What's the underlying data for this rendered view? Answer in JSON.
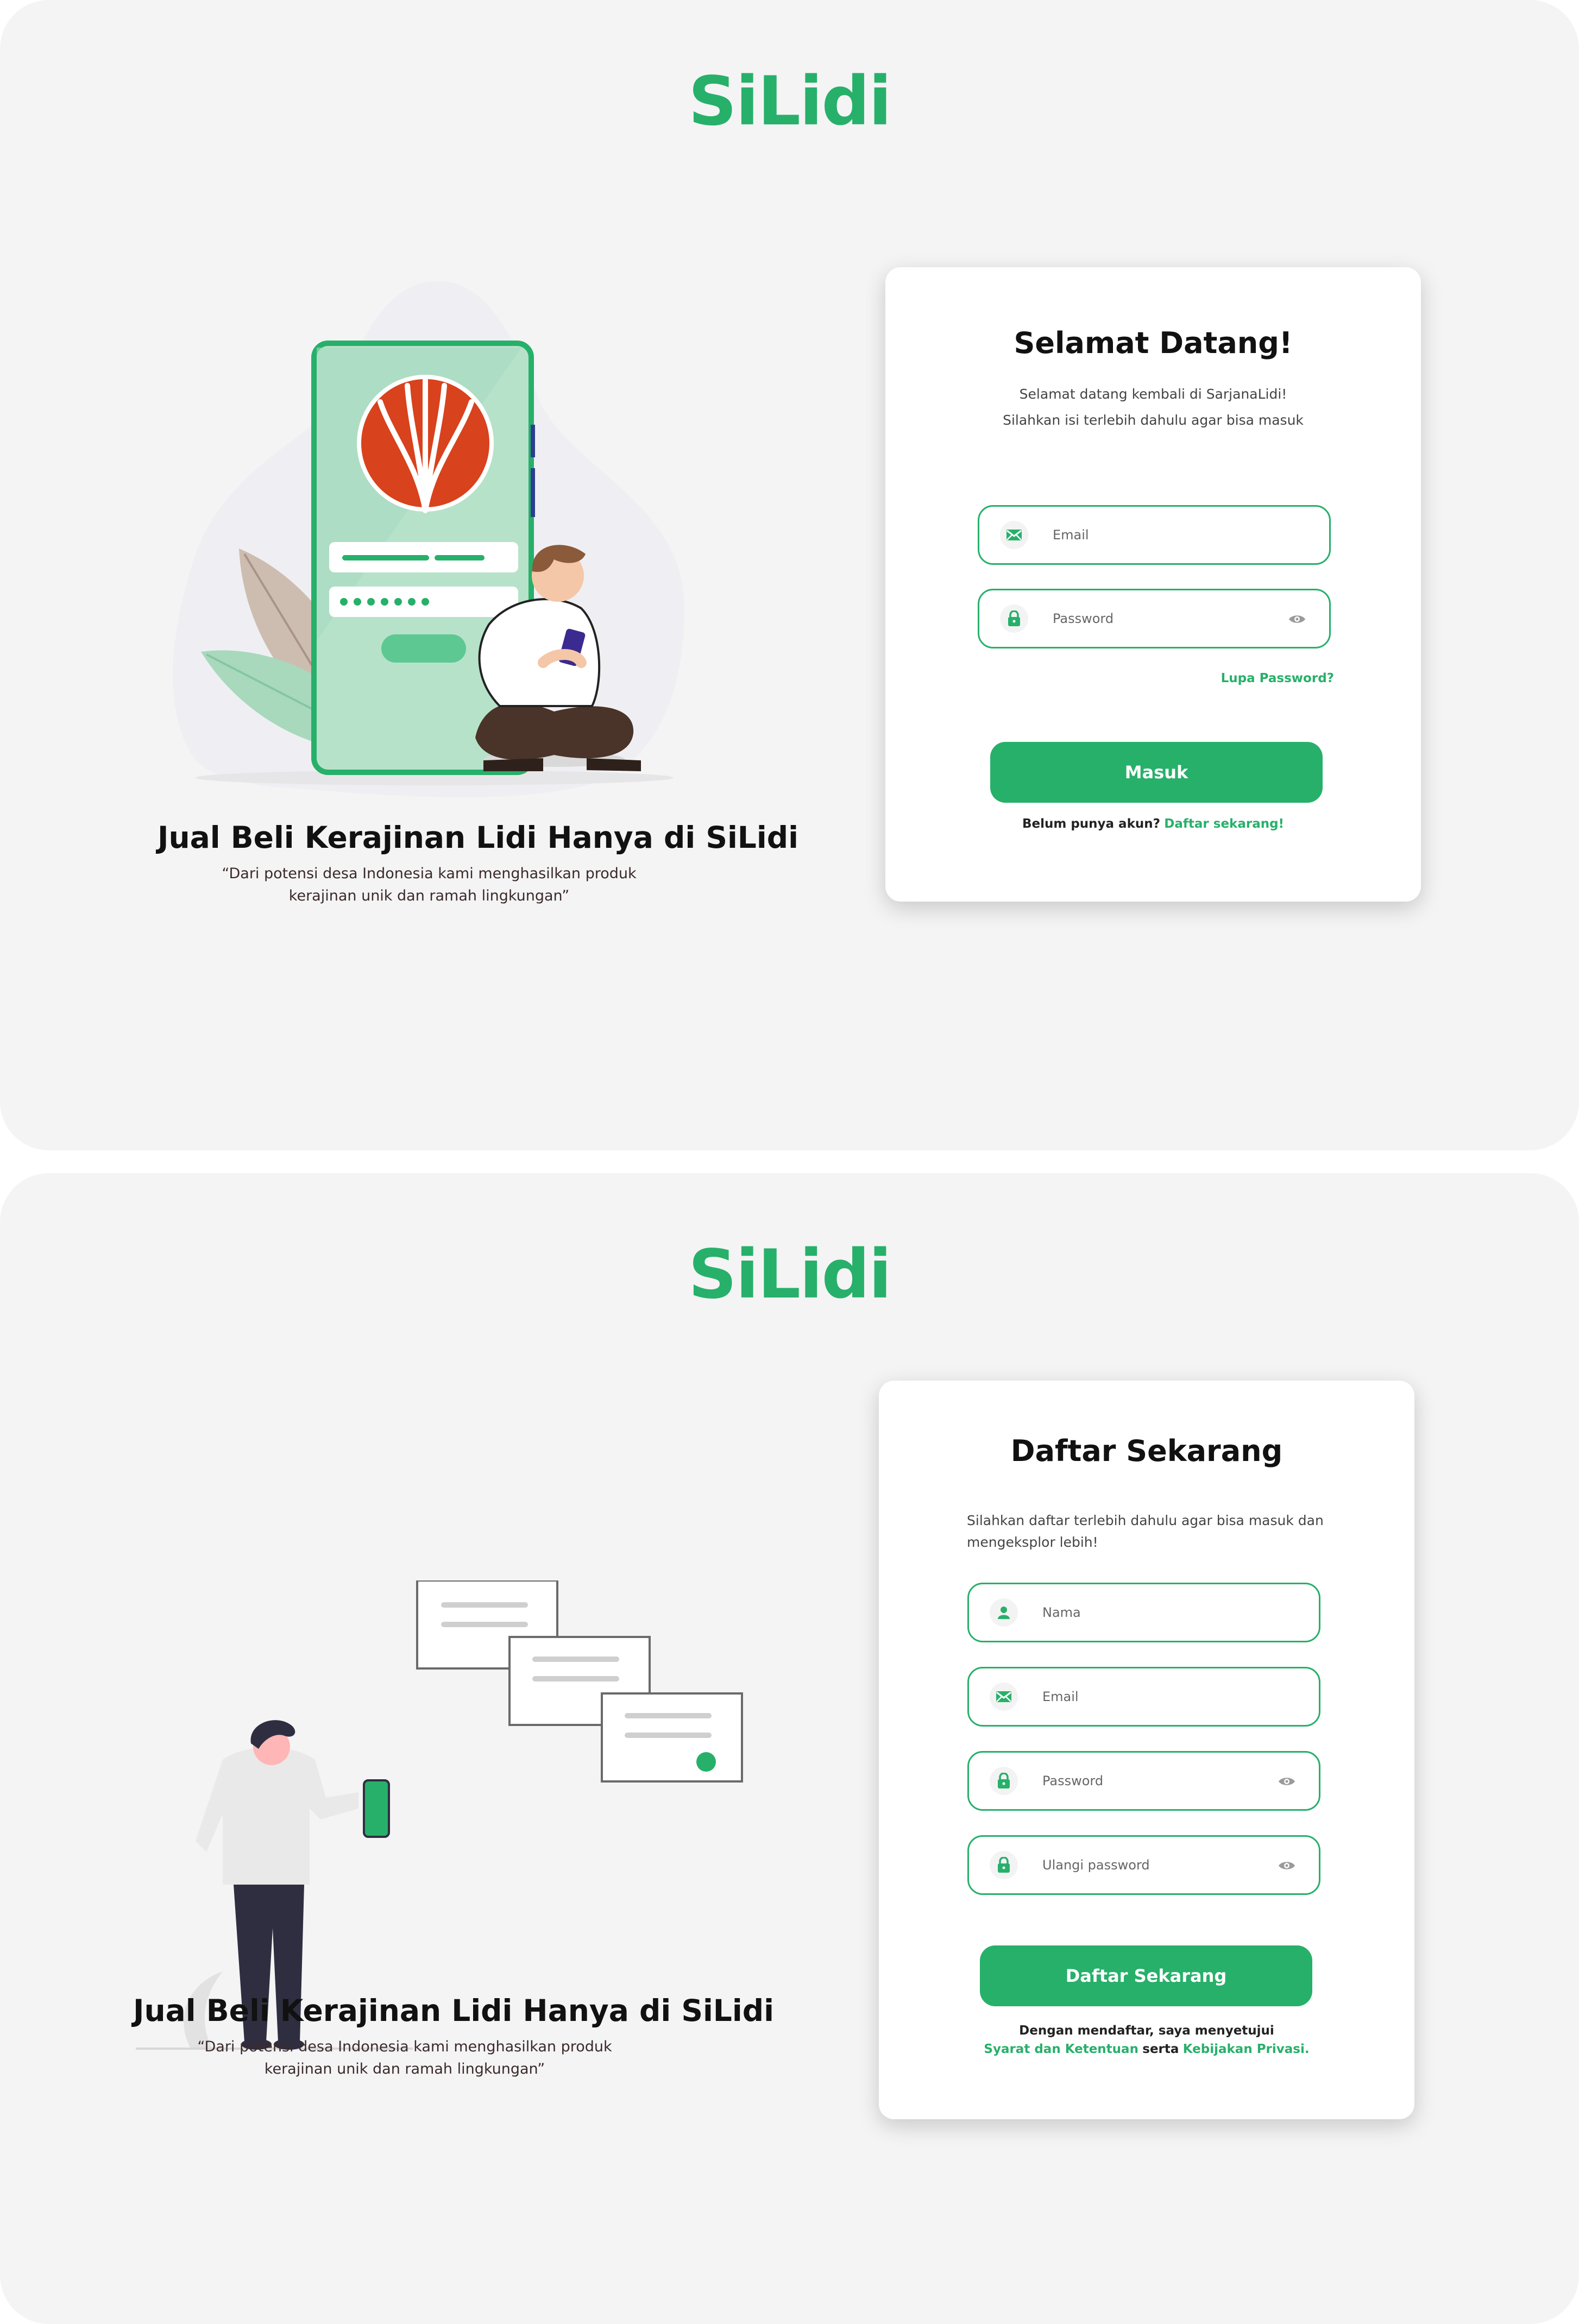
{
  "brand": {
    "logo_text": "SiLidi",
    "accent_color": "#27b06a"
  },
  "login": {
    "tagline": "Jual Beli Kerajinan Lidi Hanya di SiLidi",
    "quote_line1": "“Dari potensi desa Indonesia kami menghasilkan produk",
    "quote_line2": "kerajinan unik dan ramah lingkungan”",
    "card": {
      "title": "Selamat Datang!",
      "subtitle_line1": "Selamat datang kembali di SarjanaLidi!",
      "subtitle_line2": "Silahkan isi terlebih dahulu agar bisa masuk",
      "email_placeholder": "Email",
      "password_placeholder": "Password",
      "forgot_password": "Lupa Password?",
      "submit_label": "Masuk",
      "no_account_text": "Belum punya akun?",
      "register_link": "Daftar sekarang!"
    }
  },
  "register": {
    "tagline": "Jual Beli Kerajinan Lidi Hanya di SiLidi",
    "quote_line1": "“Dari potensi desa Indonesia kami menghasilkan produk",
    "quote_line2": "kerajinan unik dan ramah lingkungan”",
    "card": {
      "title": "Daftar Sekarang",
      "subtitle_line1": "Silahkan daftar terlebih dahulu agar bisa masuk dan",
      "subtitle_line2": "mengeksplor lebih!",
      "name_placeholder": "Nama",
      "email_placeholder": "Email",
      "password_placeholder": "Password",
      "repeat_password_placeholder": "Ulangi password",
      "submit_label": "Daftar Sekarang",
      "agree_text": "Dengan mendaftar, saya menyetujui",
      "terms_link": "Syarat dan Ketentuan",
      "and_text": "serta",
      "privacy_link": "Kebijakan Privasi."
    }
  },
  "icons": [
    "mail-icon",
    "lock-icon",
    "eye-icon",
    "user-icon",
    "dollar-icon"
  ]
}
